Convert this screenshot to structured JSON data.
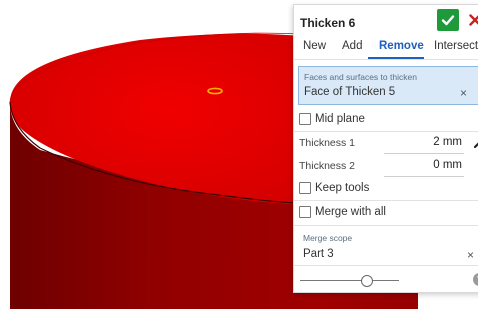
{
  "panel": {
    "title": "Thicken 6",
    "tabs": [
      {
        "label": "New"
      },
      {
        "label": "Add"
      },
      {
        "label": "Remove"
      },
      {
        "label": "Intersect"
      }
    ],
    "active_tab": "Remove",
    "selection": {
      "label": "Faces and surfaces to thicken",
      "value": "Face of Thicken 5",
      "clear": "×"
    },
    "mid_plane": {
      "label": "Mid plane",
      "checked": false
    },
    "thickness1": {
      "label": "Thickness 1",
      "value": "2 mm"
    },
    "thickness2": {
      "label": "Thickness 2",
      "value": "0 mm"
    },
    "keep_tools": {
      "label": "Keep tools",
      "checked": false
    },
    "merge_with_all": {
      "label": "Merge with all",
      "checked": false
    },
    "merge_scope": {
      "label": "Merge scope",
      "value": "Part 3",
      "clear": "×"
    },
    "slider_level": 0.68,
    "help": "?"
  },
  "colors": {
    "part_face_top": "#e60000",
    "part_side": "#a80000",
    "accept": "#1f9a3a",
    "cancel": "#cc1f1f",
    "active_tab": "#1f5fbf",
    "selection_bg": "#d9e9f8"
  },
  "icons": [
    "checkmark-icon",
    "close-icon",
    "flip-direction-arrow-icon",
    "help-icon"
  ]
}
